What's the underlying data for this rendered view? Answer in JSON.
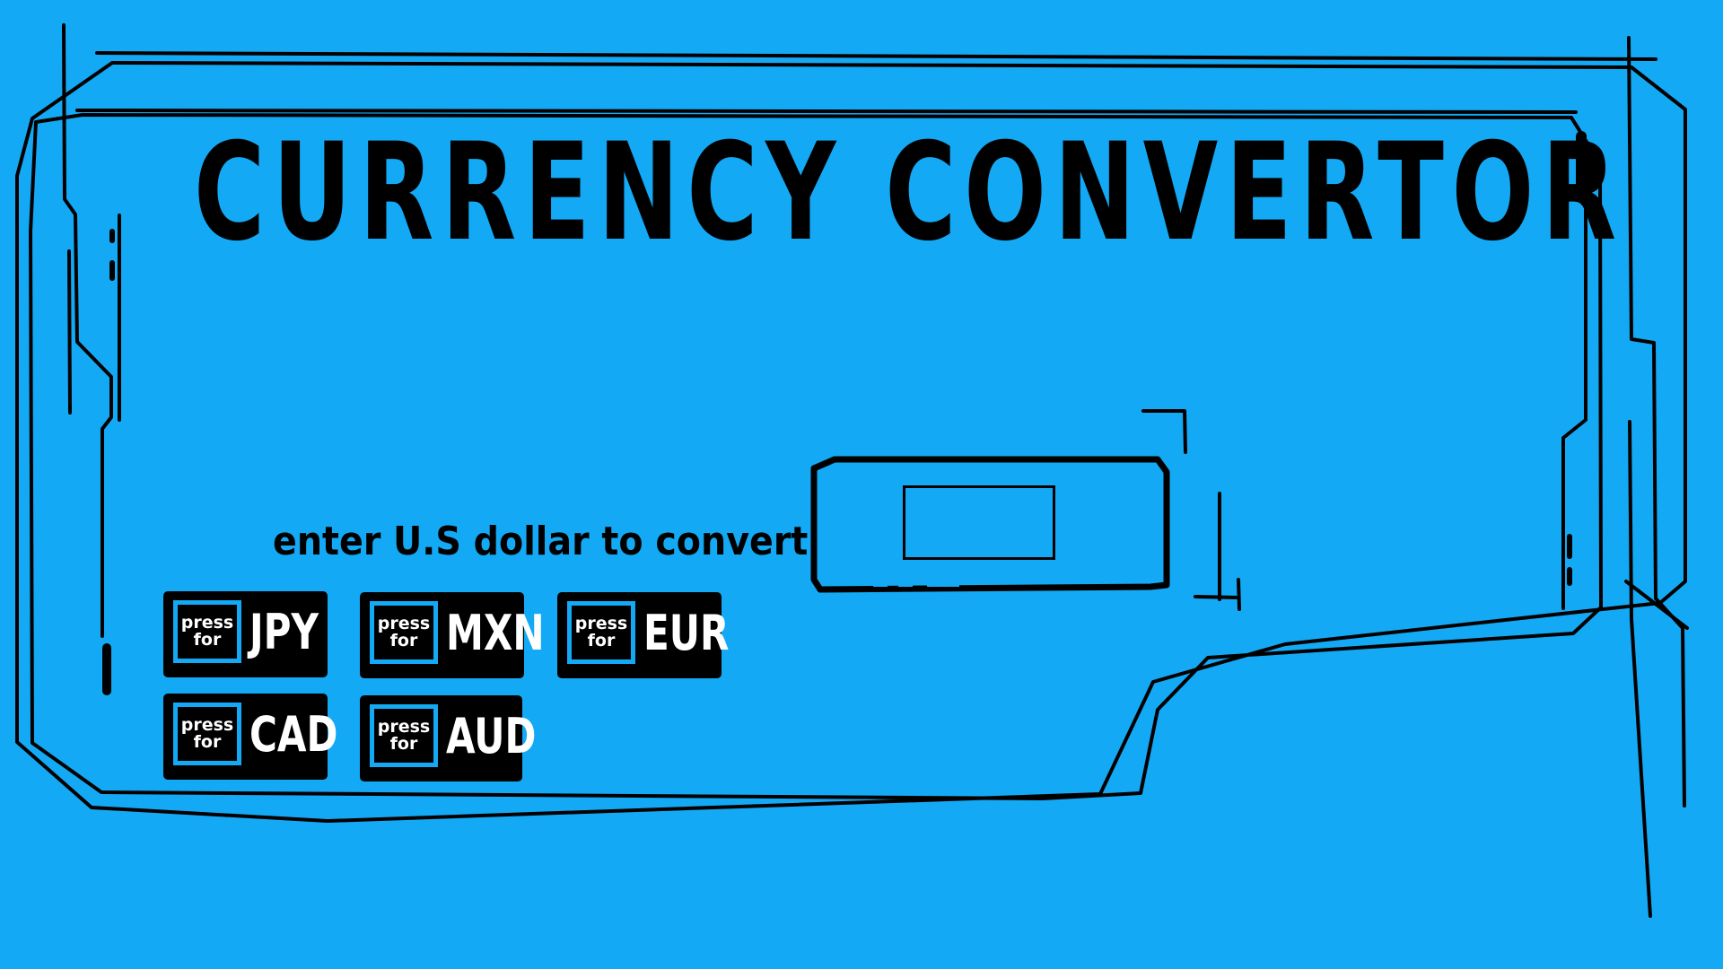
{
  "title": "CURRENCY CONVERTOR",
  "prompt": "enter U.S dollar to convert",
  "amount_input": {
    "value": "",
    "placeholder": ""
  },
  "buttons": [
    {
      "line1": "press",
      "line2": "for",
      "code": "JPY"
    },
    {
      "line1": "press",
      "line2": "for",
      "code": "MXN"
    },
    {
      "line1": "press",
      "line2": "for",
      "code": "EUR"
    },
    {
      "line1": "press",
      "line2": "for",
      "code": "CAD"
    },
    {
      "line1": "press",
      "line2": "for",
      "code": "AUD"
    }
  ],
  "colors": {
    "background": "#14a9f5",
    "ink": "#000000",
    "button_text": "#ffffff"
  }
}
